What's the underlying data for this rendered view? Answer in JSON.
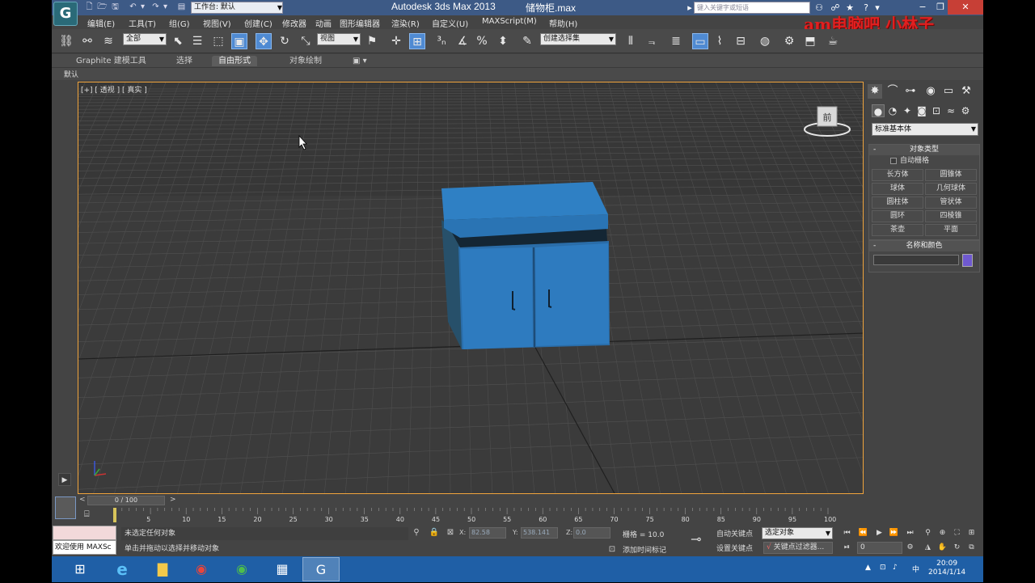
{
  "title_bar": {
    "app_title": "Autodesk 3ds Max  2013",
    "file_name": "储物柜.max",
    "workspace_label": "工作台: 默认",
    "search_placeholder": "键入关键字或短语",
    "app_icon": "3ds-max-logo-icon"
  },
  "watermark": "am电脑吧  小林子",
  "menu": {
    "items": [
      "编辑(E)",
      "工具(T)",
      "组(G)",
      "视图(V)",
      "创建(C)",
      "修改器",
      "动画",
      "图形编辑器",
      "渲染(R)",
      "自定义(U)",
      "MAXScript(M)",
      "帮助(H)"
    ]
  },
  "toolbar": {
    "selection_filter": "全部",
    "reference_coord": "视图",
    "named_selection": "创建选择集"
  },
  "ribbon": {
    "tabs": [
      "Graphite 建模工具",
      "选择",
      "自由形式",
      "对象绘制"
    ],
    "selected_tab": "自由形式",
    "sub_label": "默认"
  },
  "viewport": {
    "label": "[+] [ 透视 ] [ 真实 ]",
    "viewcube_face": "前",
    "object_color": "#2e7bbf"
  },
  "command_panel": {
    "category": "标准基本体",
    "object_type_title": "对象类型",
    "autogrid_label": "自动栅格",
    "buttons": [
      "长方体",
      "圆锥体",
      "球体",
      "几何球体",
      "圆柱体",
      "管状体",
      "圆环",
      "四棱锥",
      "茶壶",
      "平面"
    ],
    "name_color_title": "名称和颜色",
    "color": "#6f59d0"
  },
  "timeline": {
    "slider_text": "0 / 100",
    "ticks": [
      "5",
      "10",
      "15",
      "20",
      "25",
      "30",
      "35",
      "40",
      "45",
      "50",
      "55",
      "60",
      "65",
      "70",
      "75",
      "80",
      "85",
      "90",
      "95",
      "100"
    ]
  },
  "status": {
    "welcome_text": "欢迎使用 MAXSc",
    "line1": "未选定任何对象",
    "line2": "单击并拖动以选择并移动对象",
    "x_label": "X:",
    "x_value": "82.58",
    "y_label": "Y:",
    "y_value": "538.141",
    "z_label": "Z:",
    "z_value": "0.0",
    "grid_text": "栅格 = 10.0",
    "add_time_tag": "添加时间标记",
    "auto_key": "自动关键点",
    "set_key": "设置关键点",
    "selected_object": "选定对象",
    "key_filters": "关键点过滤器...",
    "frame_value": "0"
  },
  "taskbar": {
    "time": "20:09",
    "date": "2014/1/14",
    "ime": "中"
  }
}
